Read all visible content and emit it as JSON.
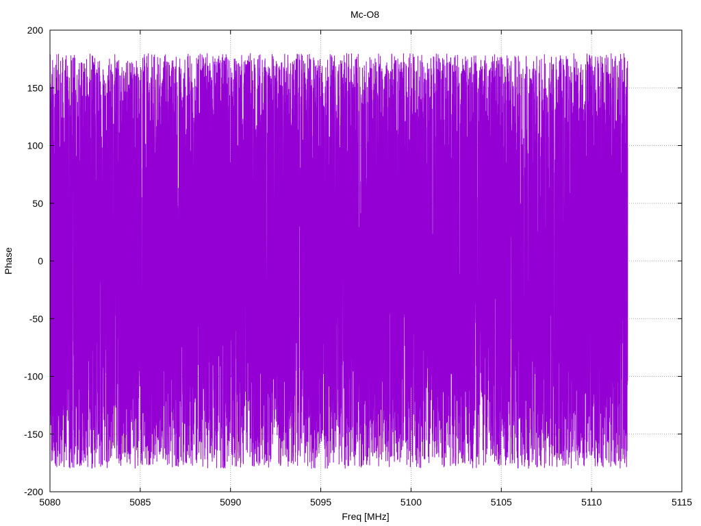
{
  "chart_data": {
    "type": "line",
    "title": "Mc-O8",
    "xlabel": "Freq [MHz]",
    "ylabel": "Phase",
    "xlim": [
      5080,
      5115
    ],
    "ylim": [
      -200,
      200
    ],
    "xticks": [
      5080,
      5085,
      5090,
      5095,
      5100,
      5105,
      5110,
      5115
    ],
    "yticks": [
      -200,
      -150,
      -100,
      -50,
      0,
      50,
      100,
      150,
      200
    ],
    "xtick_labels": [
      "5080",
      "5085",
      "5090",
      "5095",
      "5100",
      "5105",
      "5110",
      "5115"
    ],
    "ytick_labels": [
      "-200",
      "-150",
      "-100",
      "-50",
      "0",
      "50",
      "100",
      "150",
      "200"
    ],
    "grid": true,
    "legend": "none",
    "series": [
      {
        "color": "#9400d3",
        "x_range": [
          5080,
          5112
        ],
        "point_count": 8000,
        "value_range": [
          -180,
          180
        ],
        "pattern": "phase wrapping rapidly between -180 and 180 degrees across the band"
      }
    ]
  }
}
